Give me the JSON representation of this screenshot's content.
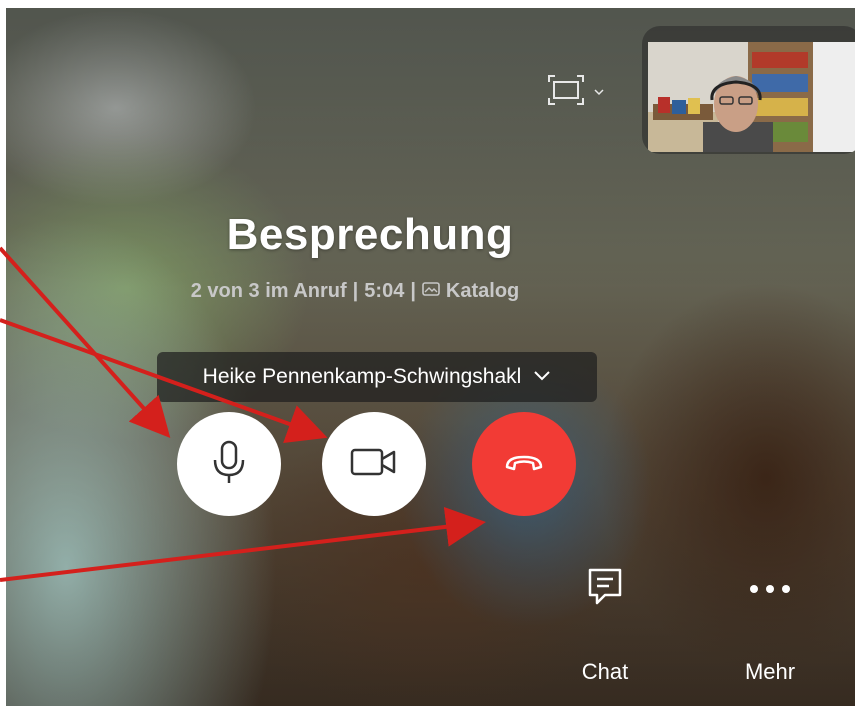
{
  "meeting": {
    "title": "Besprechung",
    "participants": "2 von 3 im Anruf",
    "separator1": "|",
    "duration": "5:04",
    "separator2": "|",
    "catalog_label": "Katalog"
  },
  "device_selector": {
    "label": "Heike Pennenkamp-Schwingshakl"
  },
  "controls": {
    "mic": "microphone-icon",
    "camera": "video-camera-icon",
    "hangup": "hang-up-icon"
  },
  "actions": {
    "chat_label": "Chat",
    "more_label": "Mehr"
  },
  "colors": {
    "hangup_red": "#f23b35",
    "annotation_arrow": "#d4201c",
    "button_white": "#ffffff"
  }
}
